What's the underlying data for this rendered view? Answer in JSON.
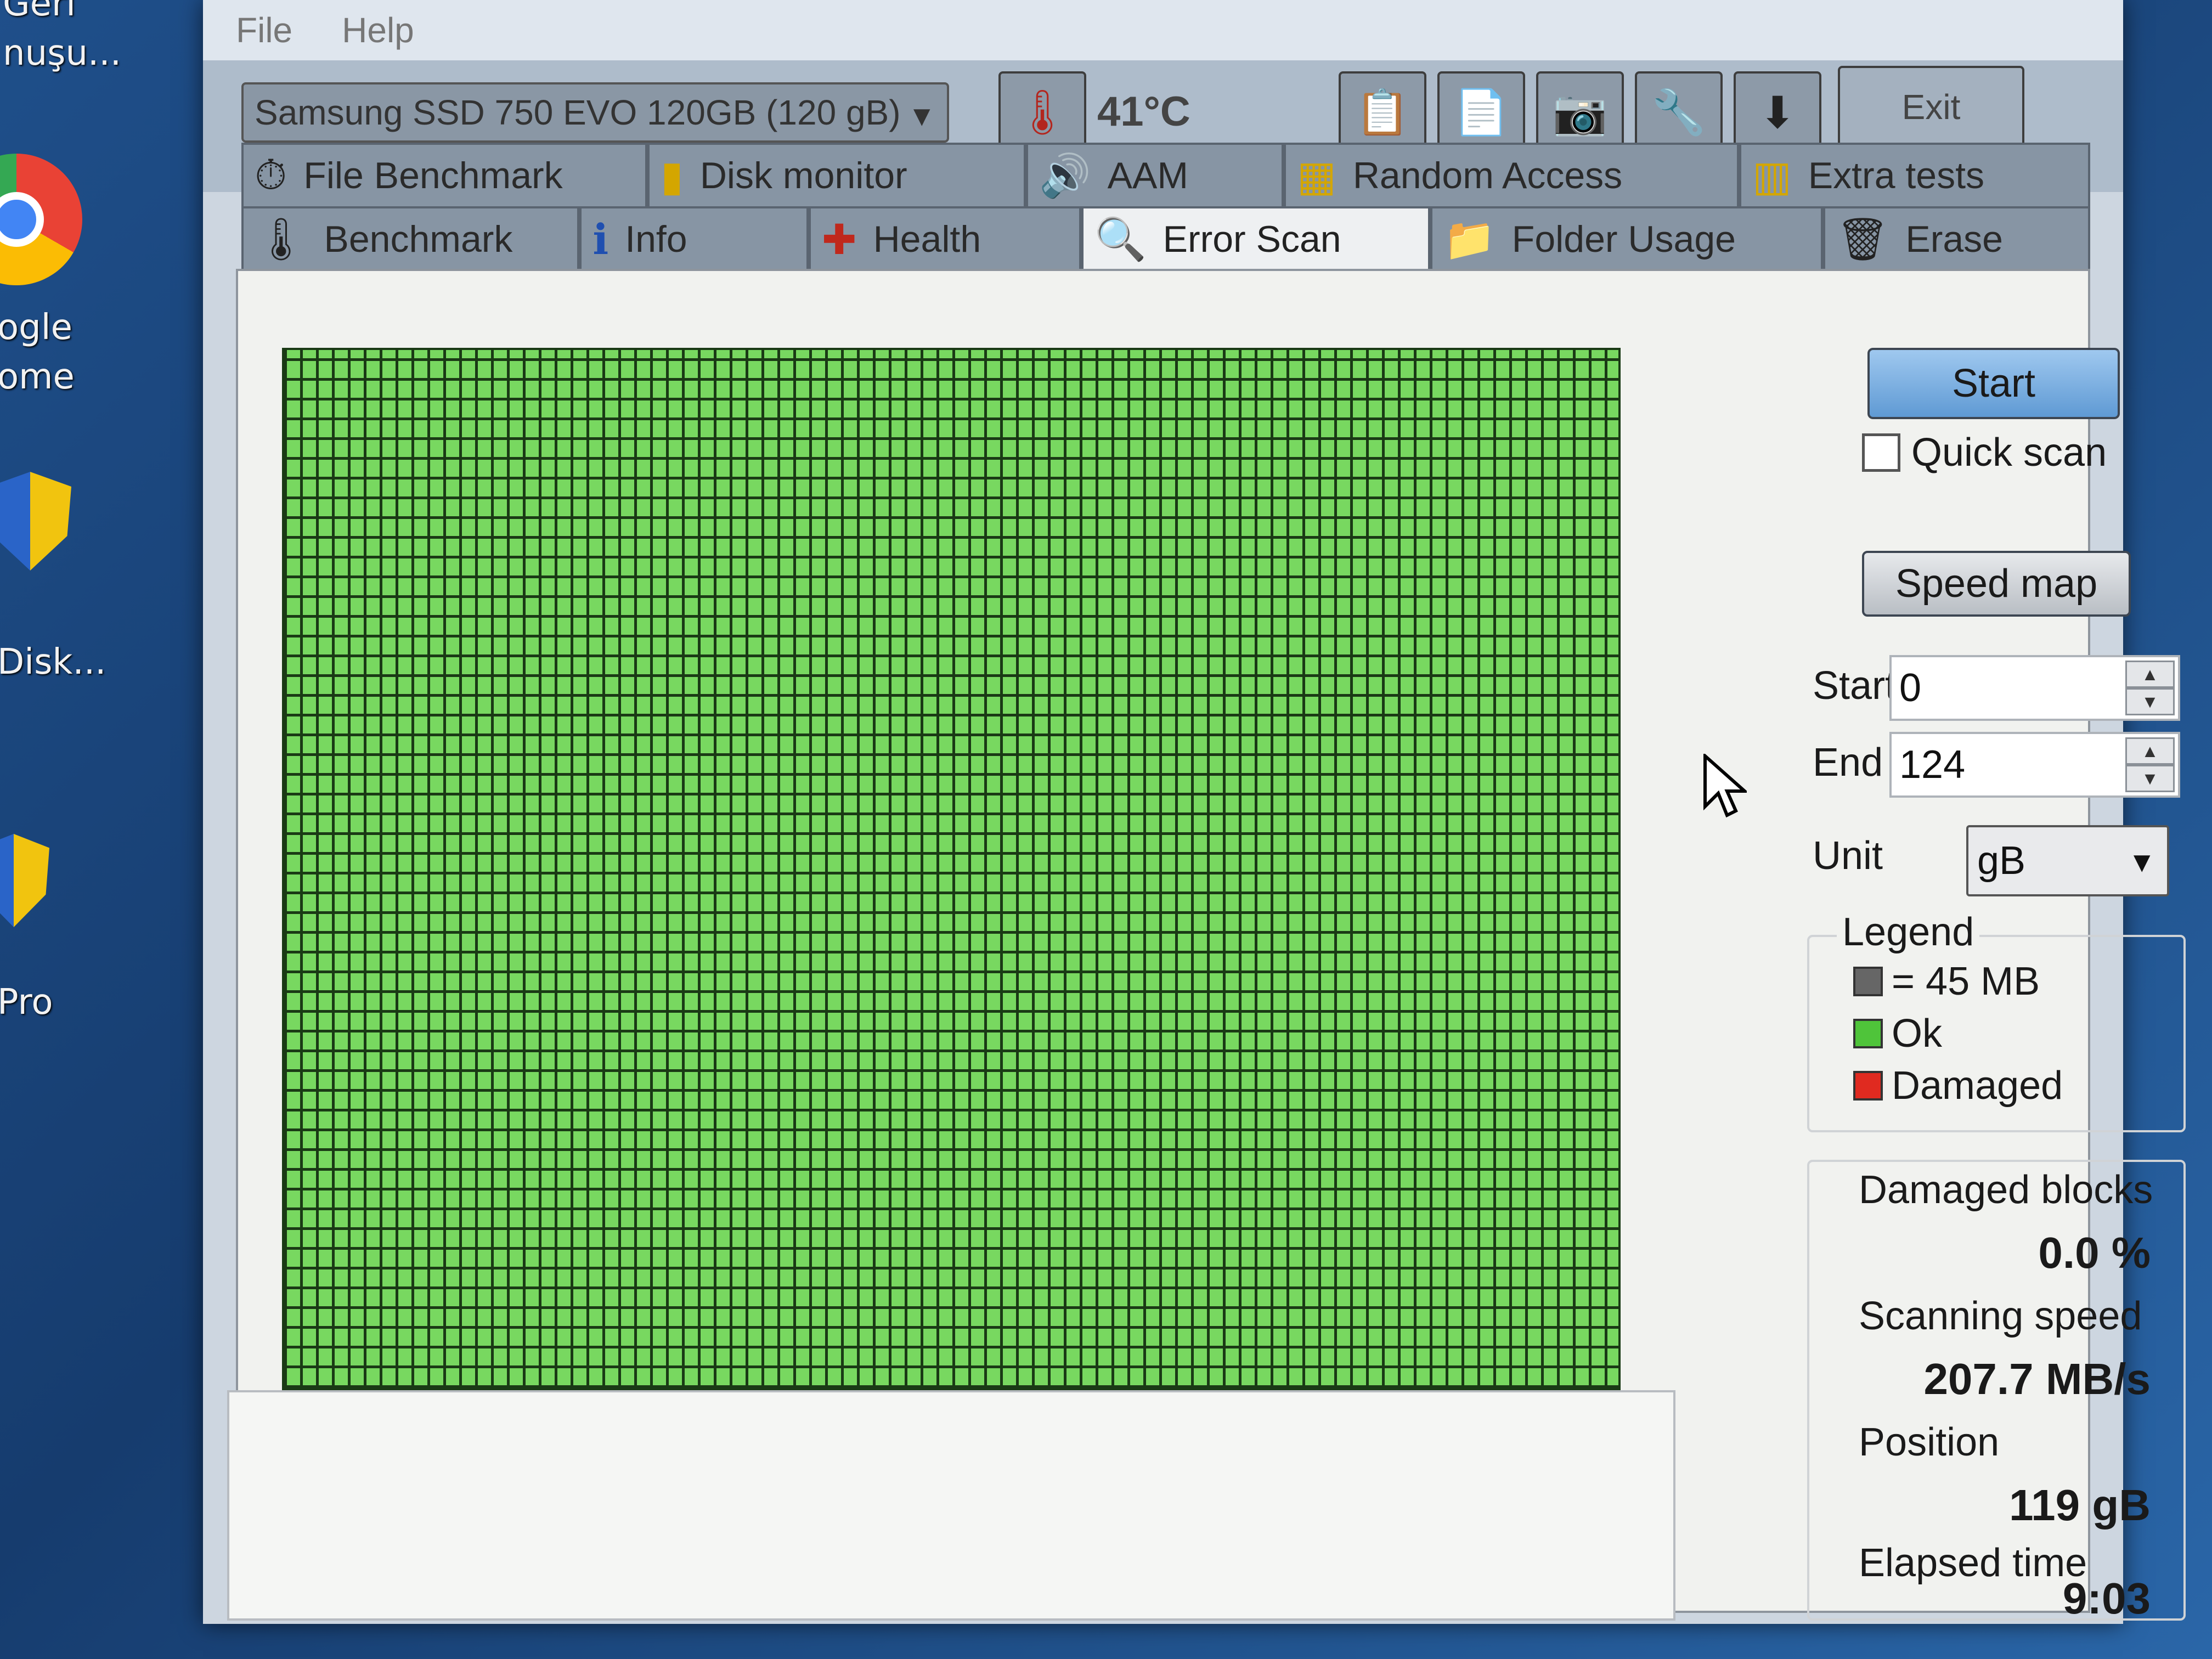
{
  "desktop": {
    "labels": [
      "Geri",
      "nuşu...",
      "ogle",
      "ome",
      "Disk...",
      "Pro"
    ]
  },
  "menu": {
    "file": "File",
    "help": "Help"
  },
  "toolbar": {
    "drive": "Samsung SSD 750 EVO 120GB (120 gB)",
    "temperature": "41°C",
    "exit": "Exit"
  },
  "tabs": {
    "row1": [
      "File Benchmark",
      "Disk monitor",
      "AAM",
      "Random Access",
      "Extra tests"
    ],
    "row2": [
      "Benchmark",
      "Info",
      "Health",
      "Error Scan",
      "Folder Usage",
      "Erase"
    ],
    "active": "Error Scan"
  },
  "scan": {
    "start_button": "Start",
    "quick_scan": "Quick scan",
    "speed_map": "Speed map",
    "start_label": "Start",
    "start_value": "0",
    "end_label": "End",
    "end_value": "124",
    "unit_label": "Unit",
    "unit_value": "gB"
  },
  "legend": {
    "title": "Legend",
    "block": "= 45 MB",
    "ok": "Ok",
    "damaged": "Damaged",
    "colors": {
      "block": "#666666",
      "ok": "#4fc43a",
      "damaged": "#e02a20"
    }
  },
  "stats": {
    "damaged_label": "Damaged blocks",
    "damaged_value": "0.0 %",
    "speed_label": "Scanning speed",
    "speed_value": "207.7 MB/s",
    "position_label": "Position",
    "position_value": "119 gB",
    "elapsed_label": "Elapsed time",
    "elapsed_value": "9:03"
  }
}
